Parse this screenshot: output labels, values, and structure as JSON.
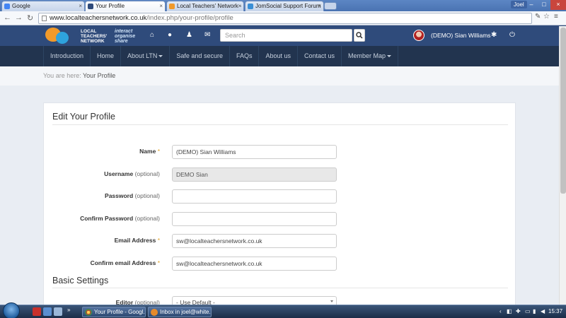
{
  "browser": {
    "tabs": [
      {
        "label": "Google",
        "active": false
      },
      {
        "label": "Your Profile",
        "active": true
      },
      {
        "label": "Local Teachers' Network ·",
        "active": false
      },
      {
        "label": "JomSocial Support Forum",
        "active": false
      }
    ],
    "window_user": "Joel",
    "url_domain": "www.localteachersnetwork.co.uk",
    "url_path": "/index.php/your-profile/profile"
  },
  "site": {
    "logo_line1": "LOCAL",
    "logo_line2": "TEACHERS'",
    "logo_line3": "NETWORK",
    "logo_tag1": "interact",
    "logo_tag2": "organise",
    "logo_tag3": "share",
    "search_placeholder": "Search",
    "username": "(DEMO) Sian Williams"
  },
  "nav": {
    "items": [
      {
        "label": "Introduction",
        "dropdown": false
      },
      {
        "label": "Home",
        "dropdown": false
      },
      {
        "label": "About LTN",
        "dropdown": true
      },
      {
        "label": "Safe and secure",
        "dropdown": false
      },
      {
        "label": "FAQs",
        "dropdown": false
      },
      {
        "label": "About us",
        "dropdown": false
      },
      {
        "label": "Contact us",
        "dropdown": false
      },
      {
        "label": "Member Map",
        "dropdown": true
      }
    ]
  },
  "breadcrumb": {
    "label": "You are here:",
    "current": "Your Profile"
  },
  "form": {
    "title": "Edit Your Profile",
    "fields": [
      {
        "label": "Name",
        "suffix": "*",
        "optional": "",
        "value": "(DEMO) Sian Williams",
        "readonly": false
      },
      {
        "label": "Username",
        "suffix": "",
        "optional": "(optional)",
        "value": "DEMO Sian",
        "readonly": true
      },
      {
        "label": "Password",
        "suffix": "",
        "optional": "(optional)",
        "value": "",
        "readonly": false
      },
      {
        "label": "Confirm Password",
        "suffix": "",
        "optional": "(optional)",
        "value": "",
        "readonly": false
      },
      {
        "label": "Email Address",
        "suffix": "*",
        "optional": "",
        "value": "sw@localteachersnetwork.co.uk",
        "readonly": false
      },
      {
        "label": "Confirm email Address",
        "suffix": "*",
        "optional": "",
        "value": "sw@localteachersnetwork.co.uk",
        "readonly": false
      }
    ],
    "basic_title": "Basic Settings",
    "editor_label": "Editor",
    "editor_optional": "(optional)",
    "editor_value": "- Use Default -"
  },
  "taskbar": {
    "tasks": [
      {
        "label": "Your Profile - Googl..."
      },
      {
        "label": "Inbox in joel@white..."
      }
    ],
    "clock": "15:37"
  }
}
